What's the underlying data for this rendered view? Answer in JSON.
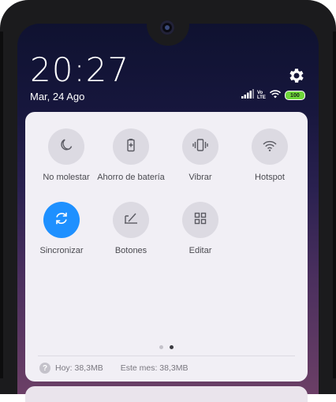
{
  "status": {
    "time": "20:27",
    "date": "Mar, 24 Ago",
    "battery": "100",
    "network_label_top": "Vo",
    "network_label_bottom": "LTE"
  },
  "icons": {
    "settings": "gear-icon",
    "signal": "signal-icon",
    "wifi": "wifi-icon"
  },
  "tiles": [
    {
      "label": "No molestar",
      "icon": "moon-icon",
      "active": false
    },
    {
      "label": "Ahorro de batería",
      "icon": "battery-saver-icon",
      "active": false
    },
    {
      "label": "Vibrar",
      "icon": "vibrate-icon",
      "active": false
    },
    {
      "label": "Hotspot",
      "icon": "hotspot-icon",
      "active": false
    },
    {
      "label": "Sincronizar",
      "icon": "sync-icon",
      "active": true
    },
    {
      "label": "Botones",
      "icon": "buttons-icon",
      "active": false
    },
    {
      "label": "Editar",
      "icon": "edit-grid-icon",
      "active": false
    }
  ],
  "pagination": {
    "pages": 2,
    "current": 2
  },
  "data_usage": {
    "today": "Hoy: 38,3MB",
    "month": "Este mes: 38,3MB"
  },
  "colors": {
    "accent": "#1e90ff",
    "panel": "#f1eff5",
    "tile": "#dcdae2",
    "battery": "#6fd73a"
  }
}
